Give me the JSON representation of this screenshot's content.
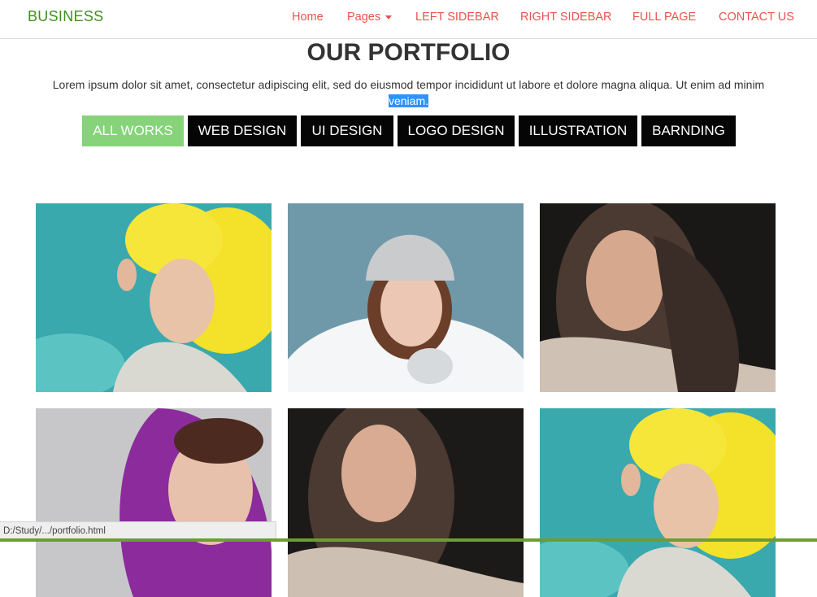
{
  "navbar": {
    "brand": "BUSINESS",
    "links": [
      {
        "label": "Home"
      },
      {
        "label": "Pages"
      },
      {
        "label": "LEFT SIDEBAR"
      },
      {
        "label": "RIGHT SIDEBAR"
      },
      {
        "label": "FULL PAGE"
      },
      {
        "label": "CONTACT US"
      }
    ]
  },
  "portfolio": {
    "title": "OUR PORTFOLIO",
    "intro": "Lorem ipsum dolor sit amet, consectetur adipiscing elit, sed do eiusmod tempor incididunt ut labore et dolore magna aliqua. Ut enim ad minim",
    "intro_selected": "veniam.",
    "filters": [
      {
        "label": "ALL WORKS",
        "active": true
      },
      {
        "label": "WEB DESIGN",
        "active": false
      },
      {
        "label": "UI DESIGN",
        "active": false
      },
      {
        "label": "LOGO DESIGN",
        "active": false
      },
      {
        "label": "ILLUSTRATION",
        "active": false
      },
      {
        "label": "BARNDING",
        "active": false
      }
    ]
  },
  "status_bar": {
    "url": "D:/Study/.../portfolio.html"
  },
  "colors": {
    "brand": "#3f8f1f",
    "nav_link": "#e8534c",
    "filter_active": "#86d37a",
    "filter_default": "#050505"
  }
}
